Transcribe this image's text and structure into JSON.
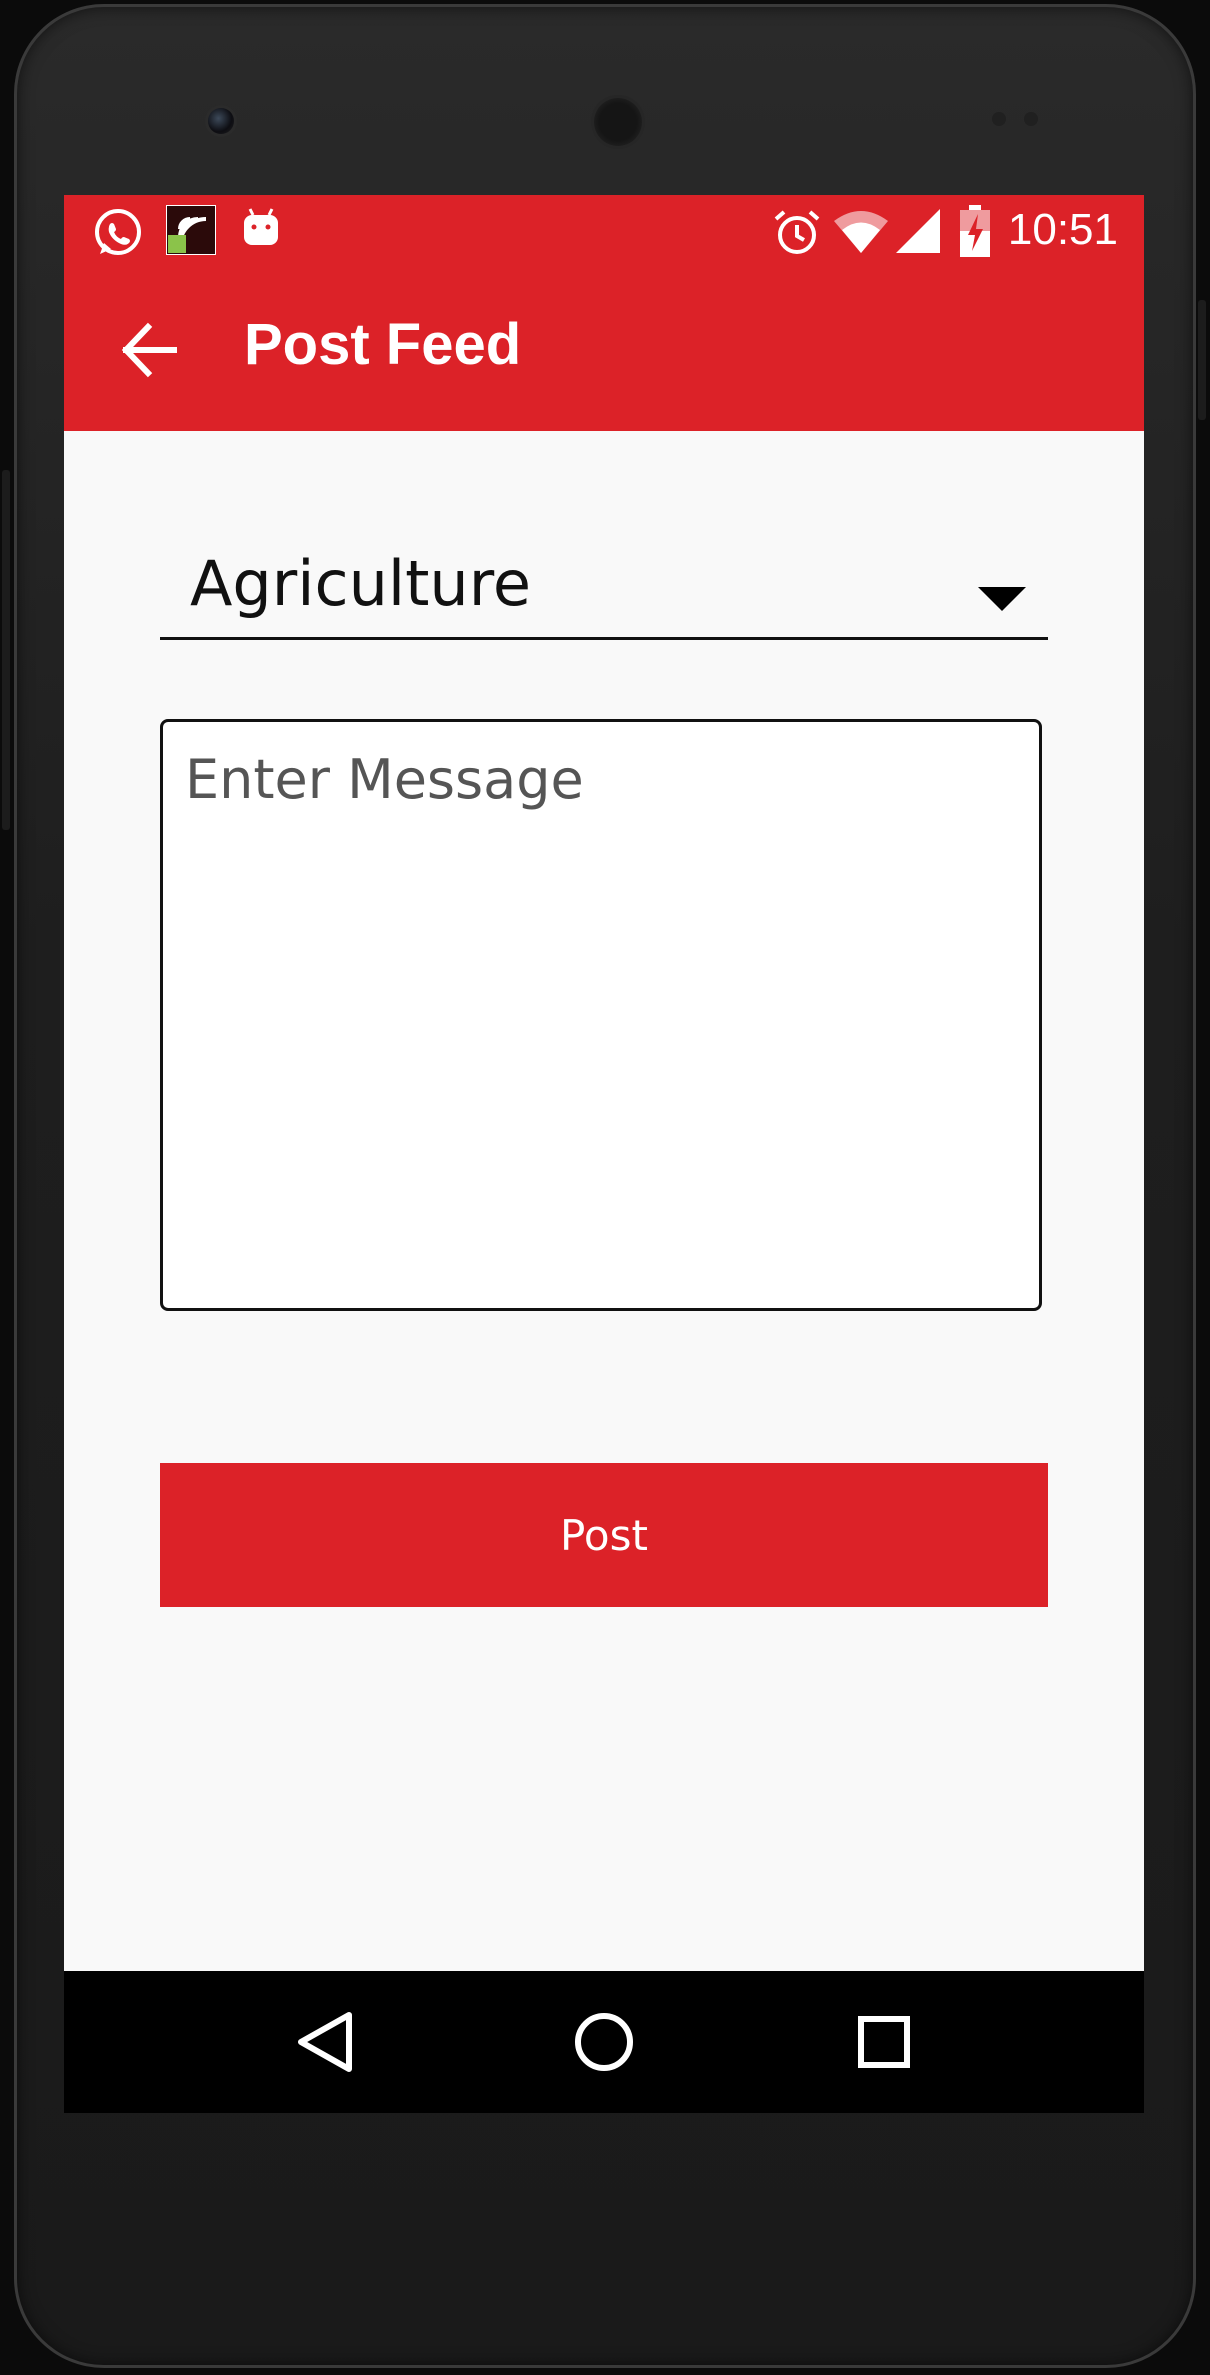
{
  "status_bar": {
    "time": "10:51",
    "icons": [
      "whatsapp-icon",
      "cast-app-icon",
      "android-icon",
      "alarm-icon",
      "wifi-icon",
      "signal-icon",
      "battery-charging-icon"
    ]
  },
  "toolbar": {
    "title": "Post Feed",
    "back_icon": "arrow-left-icon"
  },
  "form": {
    "category_selected": "Agriculture",
    "message_placeholder": "Enter Message",
    "message_value": "",
    "post_label": "Post"
  },
  "nav_bar": {
    "icons": [
      "back-triangle-icon",
      "home-circle-icon",
      "recents-square-icon"
    ]
  },
  "colors": {
    "accent": "#dc2228",
    "background": "#f9f9f9"
  }
}
